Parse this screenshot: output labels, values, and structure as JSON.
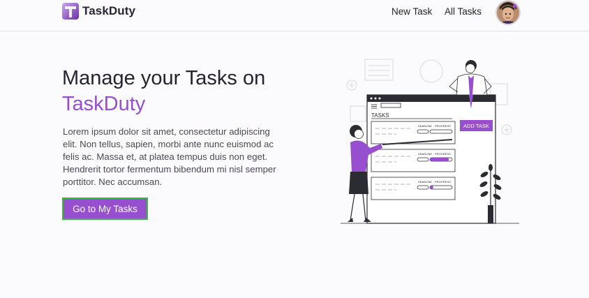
{
  "brand": {
    "logo_letter": "T",
    "name": "TaskDuty"
  },
  "nav": {
    "new_task": "New Task",
    "all_tasks": "All Tasks"
  },
  "hero": {
    "title_line1": "Manage your Tasks on",
    "title_accent": "TaskDuty",
    "description": "Lorem ipsum dolor sit amet, consectetur adipiscing elit. Non tellus, sapien, morbi ante nunc euismod ac felis ac. Massa et, at platea tempus duis non eget. Hendrerit tortor fermentum bibendum mi nisl semper porttitor. Nec accumsan.",
    "cta_label": "Go to My Tasks"
  },
  "illustration": {
    "board_title": "TASKS",
    "add_task_label": "ADD TASK",
    "deadline_label": "DEADLINE",
    "progress_label": "PROGRESS",
    "task_progress": [
      0,
      0.85,
      0.15
    ]
  },
  "colors": {
    "accent": "#974fd0",
    "cta_border": "#39b54a",
    "text_dark": "#262330"
  }
}
